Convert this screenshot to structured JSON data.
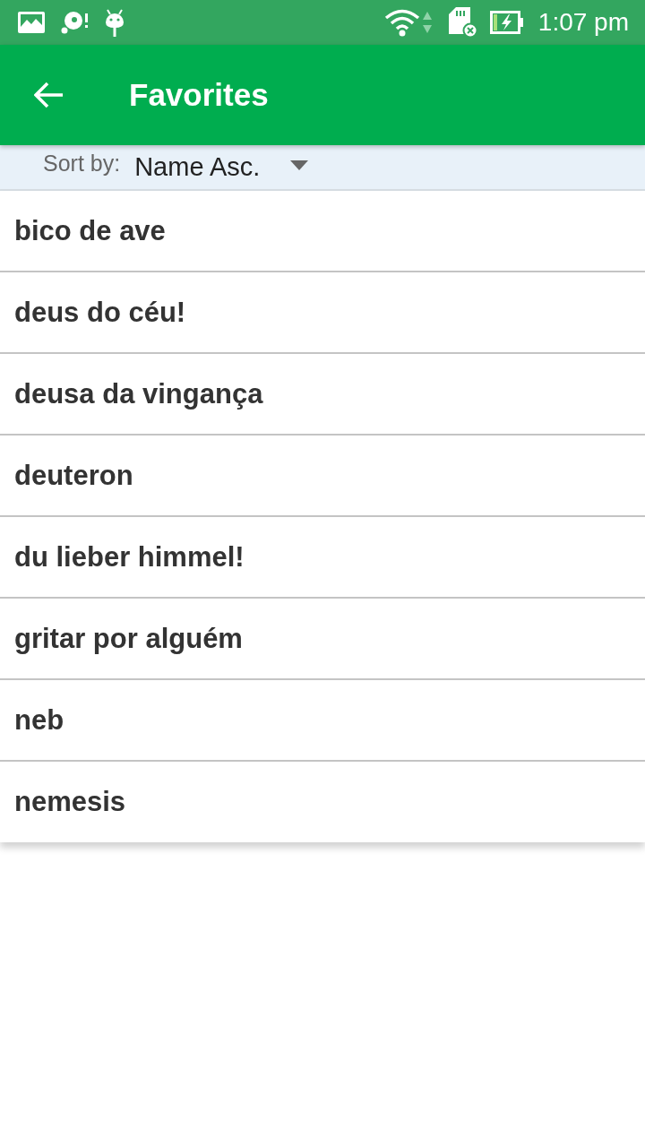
{
  "status_bar": {
    "time": "1:07 pm"
  },
  "app_bar": {
    "title": "Favorites"
  },
  "sort": {
    "label": "Sort by:",
    "value": "Name Asc."
  },
  "favorites": [
    {
      "text": "bico de ave"
    },
    {
      "text": "deus do céu!"
    },
    {
      "text": "deusa da vingança"
    },
    {
      "text": "deuteron"
    },
    {
      "text": "du lieber himmel!"
    },
    {
      "text": "gritar por alguém"
    },
    {
      "text": "neb"
    },
    {
      "text": "nemesis"
    }
  ]
}
